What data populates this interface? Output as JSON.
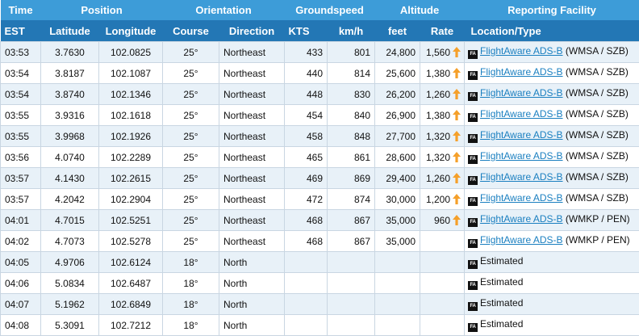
{
  "header": {
    "groups": [
      "Time",
      "Position",
      "Orientation",
      "Groundspeed",
      "Altitude",
      "Reporting Facility"
    ],
    "columns": [
      "EST",
      "Latitude",
      "Longitude",
      "Course",
      "Direction",
      "KTS",
      "km/h",
      "feet",
      "Rate",
      "Location/Type"
    ]
  },
  "icons": {
    "climb_arrow": "up-arrow-icon",
    "source_badge": "flightaware-badge-icon",
    "badge_text": "FA"
  },
  "colors": {
    "header_top": "#3d9cd8",
    "header_sub": "#2377b5",
    "row_alt": "#e8f1f8",
    "arrow": "#f5a02a",
    "link": "#1a7fc0"
  },
  "rows": [
    {
      "time": "03:53",
      "lat": "3.7630",
      "lon": "102.0825",
      "course": "25°",
      "dir": "Northeast",
      "kts": "433",
      "kmh": "801",
      "feet": "24,800",
      "rate": "1,560",
      "climbing": true,
      "source": "FlightAware ADS-B",
      "facility": "(WMSA / SZB)",
      "linked": true
    },
    {
      "time": "03:54",
      "lat": "3.8187",
      "lon": "102.1087",
      "course": "25°",
      "dir": "Northeast",
      "kts": "440",
      "kmh": "814",
      "feet": "25,600",
      "rate": "1,380",
      "climbing": true,
      "source": "FlightAware ADS-B",
      "facility": "(WMSA / SZB)",
      "linked": true
    },
    {
      "time": "03:54",
      "lat": "3.8740",
      "lon": "102.1346",
      "course": "25°",
      "dir": "Northeast",
      "kts": "448",
      "kmh": "830",
      "feet": "26,200",
      "rate": "1,260",
      "climbing": true,
      "source": "FlightAware ADS-B",
      "facility": "(WMSA / SZB)",
      "linked": true
    },
    {
      "time": "03:55",
      "lat": "3.9316",
      "lon": "102.1618",
      "course": "25°",
      "dir": "Northeast",
      "kts": "454",
      "kmh": "840",
      "feet": "26,900",
      "rate": "1,380",
      "climbing": true,
      "source": "FlightAware ADS-B",
      "facility": "(WMSA / SZB)",
      "linked": true
    },
    {
      "time": "03:55",
      "lat": "3.9968",
      "lon": "102.1926",
      "course": "25°",
      "dir": "Northeast",
      "kts": "458",
      "kmh": "848",
      "feet": "27,700",
      "rate": "1,320",
      "climbing": true,
      "source": "FlightAware ADS-B",
      "facility": "(WMSA / SZB)",
      "linked": true
    },
    {
      "time": "03:56",
      "lat": "4.0740",
      "lon": "102.2289",
      "course": "25°",
      "dir": "Northeast",
      "kts": "465",
      "kmh": "861",
      "feet": "28,600",
      "rate": "1,320",
      "climbing": true,
      "source": "FlightAware ADS-B",
      "facility": "(WMSA / SZB)",
      "linked": true
    },
    {
      "time": "03:57",
      "lat": "4.1430",
      "lon": "102.2615",
      "course": "25°",
      "dir": "Northeast",
      "kts": "469",
      "kmh": "869",
      "feet": "29,400",
      "rate": "1,260",
      "climbing": true,
      "source": "FlightAware ADS-B",
      "facility": "(WMSA / SZB)",
      "linked": true
    },
    {
      "time": "03:57",
      "lat": "4.2042",
      "lon": "102.2904",
      "course": "25°",
      "dir": "Northeast",
      "kts": "472",
      "kmh": "874",
      "feet": "30,000",
      "rate": "1,200",
      "climbing": true,
      "source": "FlightAware ADS-B",
      "facility": "(WMSA / SZB)",
      "linked": true
    },
    {
      "time": "04:01",
      "lat": "4.7015",
      "lon": "102.5251",
      "course": "25°",
      "dir": "Northeast",
      "kts": "468",
      "kmh": "867",
      "feet": "35,000",
      "rate": "960",
      "climbing": true,
      "source": "FlightAware ADS-B",
      "facility": "(WMKP / PEN)",
      "linked": true
    },
    {
      "time": "04:02",
      "lat": "4.7073",
      "lon": "102.5278",
      "course": "25°",
      "dir": "Northeast",
      "kts": "468",
      "kmh": "867",
      "feet": "35,000",
      "rate": "",
      "climbing": false,
      "source": "FlightAware ADS-B",
      "facility": "(WMKP / PEN)",
      "linked": true
    },
    {
      "time": "04:05",
      "lat": "4.9706",
      "lon": "102.6124",
      "course": "18°",
      "dir": "North",
      "kts": "",
      "kmh": "",
      "feet": "",
      "rate": "",
      "climbing": false,
      "source": "Estimated",
      "facility": "",
      "linked": false
    },
    {
      "time": "04:06",
      "lat": "5.0834",
      "lon": "102.6487",
      "course": "18°",
      "dir": "North",
      "kts": "",
      "kmh": "",
      "feet": "",
      "rate": "",
      "climbing": false,
      "source": "Estimated",
      "facility": "",
      "linked": false
    },
    {
      "time": "04:07",
      "lat": "5.1962",
      "lon": "102.6849",
      "course": "18°",
      "dir": "North",
      "kts": "",
      "kmh": "",
      "feet": "",
      "rate": "",
      "climbing": false,
      "source": "Estimated",
      "facility": "",
      "linked": false
    },
    {
      "time": "04:08",
      "lat": "5.3091",
      "lon": "102.7212",
      "course": "18°",
      "dir": "North",
      "kts": "",
      "kmh": "",
      "feet": "",
      "rate": "",
      "climbing": false,
      "source": "Estimated",
      "facility": "",
      "linked": false
    }
  ]
}
